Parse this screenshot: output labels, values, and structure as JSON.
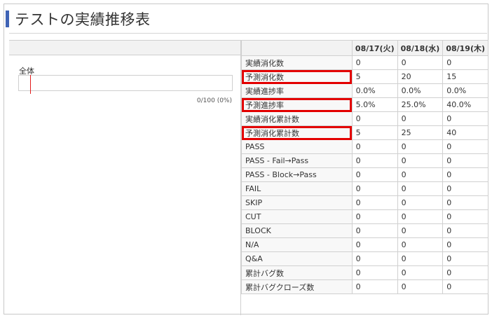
{
  "page": {
    "title": "テストの実績推移表"
  },
  "overall": {
    "label": "全体",
    "progress_text": "0/100 (0%)",
    "progress_fraction": 0
  },
  "table": {
    "dates": [
      "08/17(火)",
      "08/18(水)",
      "08/19(木)"
    ],
    "rows": [
      {
        "metric": "実績消化数",
        "values": [
          "0",
          "0",
          "0"
        ],
        "highlighted": false
      },
      {
        "metric": "予測消化数",
        "values": [
          "5",
          "20",
          "15"
        ],
        "highlighted": true
      },
      {
        "metric": "実績進捗率",
        "values": [
          "0.0%",
          "0.0%",
          "0.0%"
        ],
        "highlighted": false
      },
      {
        "metric": "予測進捗率",
        "values": [
          "5.0%",
          "25.0%",
          "40.0%"
        ],
        "highlighted": true
      },
      {
        "metric": "実績消化累計数",
        "values": [
          "0",
          "0",
          "0"
        ],
        "highlighted": false
      },
      {
        "metric": "予測消化累計数",
        "values": [
          "5",
          "25",
          "40"
        ],
        "highlighted": true
      },
      {
        "metric": "PASS",
        "values": [
          "0",
          "0",
          "0"
        ],
        "highlighted": false
      },
      {
        "metric": "PASS - Fail→Pass",
        "values": [
          "0",
          "0",
          "0"
        ],
        "highlighted": false
      },
      {
        "metric": "PASS - Block→Pass",
        "values": [
          "0",
          "0",
          "0"
        ],
        "highlighted": false
      },
      {
        "metric": "FAIL",
        "values": [
          "0",
          "0",
          "0"
        ],
        "highlighted": false
      },
      {
        "metric": "SKIP",
        "values": [
          "0",
          "0",
          "0"
        ],
        "highlighted": false
      },
      {
        "metric": "CUT",
        "values": [
          "0",
          "0",
          "0"
        ],
        "highlighted": false
      },
      {
        "metric": "BLOCK",
        "values": [
          "0",
          "0",
          "0"
        ],
        "highlighted": false
      },
      {
        "metric": "N/A",
        "values": [
          "0",
          "0",
          "0"
        ],
        "highlighted": false
      },
      {
        "metric": "Q&A",
        "values": [
          "0",
          "0",
          "0"
        ],
        "highlighted": false
      },
      {
        "metric": "累計バグ数",
        "values": [
          "0",
          "0",
          "0"
        ],
        "highlighted": false
      },
      {
        "metric": "累計バグクローズ数",
        "values": [
          "0",
          "0",
          "0"
        ],
        "highlighted": false
      }
    ]
  },
  "colors": {
    "accent": "#3f63b5",
    "highlight": "#e30000",
    "marker": "#e31b1b"
  }
}
